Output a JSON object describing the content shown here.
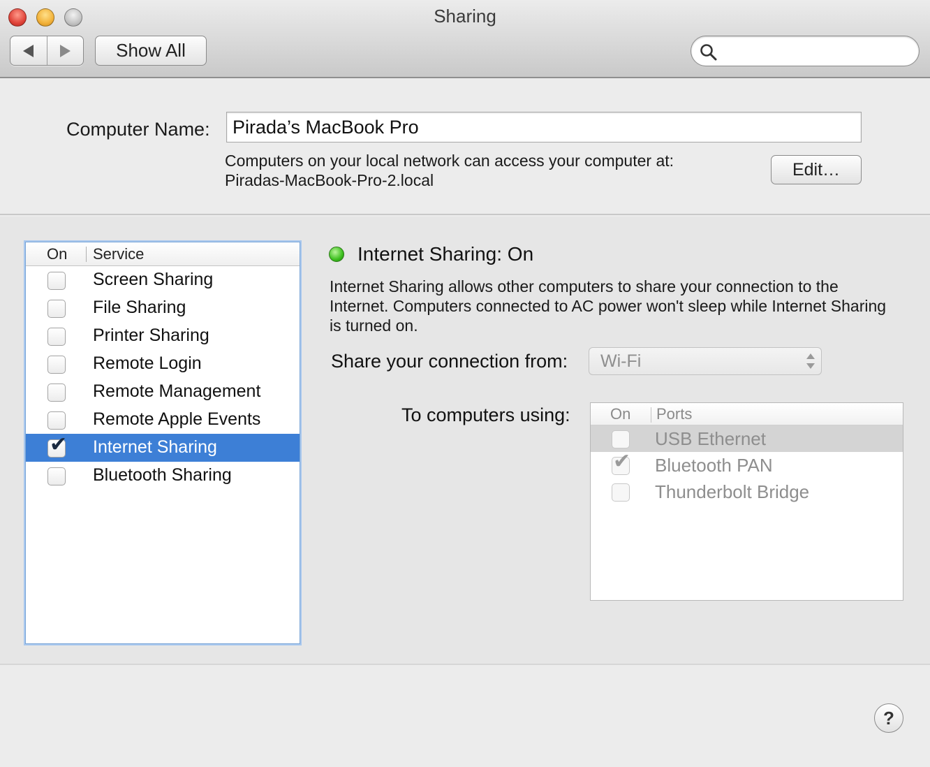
{
  "window": {
    "title": "Sharing"
  },
  "toolbar": {
    "show_all_label": "Show All",
    "search_placeholder": "",
    "search_value": ""
  },
  "computer_name": {
    "label": "Computer Name:",
    "value": "Pirada’s MacBook Pro",
    "description_line1": "Computers on your local network can access your computer at:",
    "local_address": "Piradas-MacBook-Pro-2.local",
    "edit_label": "Edit…"
  },
  "services": {
    "header_on": "On",
    "header_service": "Service",
    "items": [
      {
        "label": "Screen Sharing",
        "checked": false,
        "selected": false
      },
      {
        "label": "File Sharing",
        "checked": false,
        "selected": false
      },
      {
        "label": "Printer Sharing",
        "checked": false,
        "selected": false
      },
      {
        "label": "Remote Login",
        "checked": false,
        "selected": false
      },
      {
        "label": "Remote Management",
        "checked": false,
        "selected": false
      },
      {
        "label": "Remote Apple Events",
        "checked": false,
        "selected": false
      },
      {
        "label": "Internet Sharing",
        "checked": true,
        "selected": true
      },
      {
        "label": "Bluetooth Sharing",
        "checked": false,
        "selected": false
      }
    ]
  },
  "detail": {
    "status_title": "Internet Sharing: On",
    "status_color": "#3cbf1e",
    "description": "Internet Sharing allows other computers to share your connection to the Internet. Computers connected to AC power won't sleep while Internet Sharing is turned on.",
    "share_from_label": "Share your connection from:",
    "share_from_value": "Wi-Fi",
    "to_computers_label": "To computers using:",
    "ports_header_on": "On",
    "ports_header_ports": "Ports",
    "ports": [
      {
        "label": "USB Ethernet",
        "checked": false,
        "selected": true
      },
      {
        "label": "Bluetooth PAN",
        "checked": true,
        "selected": false
      },
      {
        "label": "Thunderbolt Bridge",
        "checked": false,
        "selected": false
      }
    ]
  },
  "help_label": "?",
  "colors": {
    "selection": "#3d7fd6",
    "window_bg": "#ececec"
  }
}
